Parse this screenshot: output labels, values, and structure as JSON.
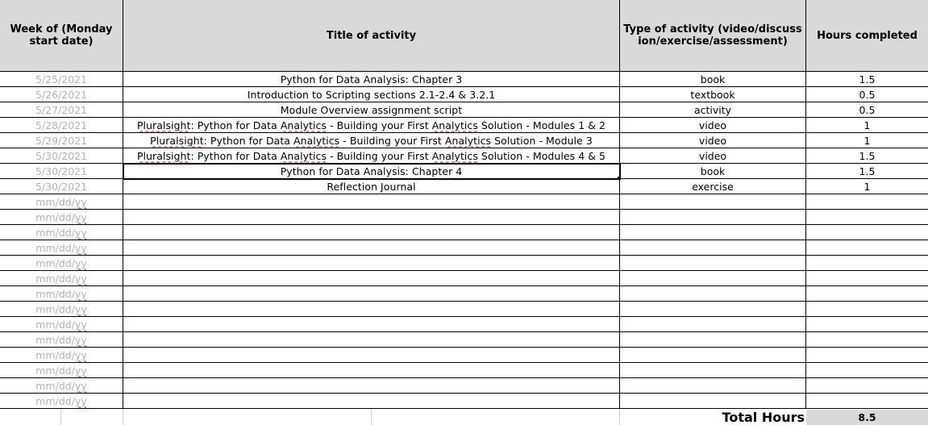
{
  "header": {
    "week": "Week of (Monday start date)",
    "title": "Title of activity",
    "type": "Type of activity (video/discussion/exercise/assessment)",
    "hours": "Hours completed"
  },
  "rows": [
    {
      "date": "5/25/2021",
      "title": "Python for Data Analysis: Chapter 3",
      "type": "book",
      "hours": "1.5"
    },
    {
      "date": "5/26/2021",
      "title": "Introduction to Scripting sections 2.1-2.4 & 3.2.1",
      "type": "textbook",
      "hours": "0.5"
    },
    {
      "date": "5/27/2021",
      "title": "Module Overview assignment script",
      "type": "activity",
      "hours": "0.5"
    },
    {
      "date": "5/28/2021",
      "title": "Pluralsight: Python for Data Analytics - Building your First Analytics Solution - Modules 1 & 2",
      "type": "video",
      "hours": "1"
    },
    {
      "date": "5/29/2021",
      "title": "Pluralsight: Python for Data Analytics - Building your First Analytics Solution - Module 3",
      "type": "video",
      "hours": "1"
    },
    {
      "date": "5/30/2021",
      "title": "Pluralsight: Python for Data Analytics - Building your First Analytics Solution - Modules 4 & 5",
      "type": "video",
      "hours": "1.5"
    },
    {
      "date": "5/30/2021",
      "title": "Python for Data Analysis: Chapter 4",
      "type": "book",
      "hours": "1.5"
    },
    {
      "date": "5/30/2021",
      "title": "Reflection Journal",
      "type": "exercise",
      "hours": "1"
    }
  ],
  "placeholder_date": "mm/dd/yy",
  "empty_row_count": 14,
  "footer": {
    "total_label": "Total Hours",
    "total_value": "8.5"
  },
  "colors": {
    "header_bg": "#d9d9d9",
    "date_text": "#b3b3b3",
    "spellcheck": "#e02020"
  }
}
